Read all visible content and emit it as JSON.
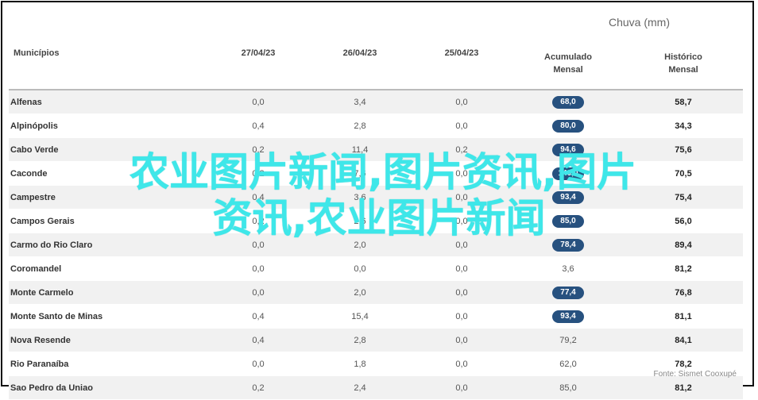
{
  "chart_title": "Chuva (mm)",
  "source": "Fonte: Sismet Cooxupé",
  "overlay": {
    "line1": "农业图片新闻,图片资讯,图片",
    "line2": "资讯,农业图片新闻"
  },
  "table": {
    "headers": {
      "municipio": "Municípios",
      "d1": "27/04/23",
      "d2": "26/04/23",
      "d3": "25/04/23",
      "acum_1": "Acumulado",
      "acum_2": "Mensal",
      "hist_1": "Histórico",
      "hist_2": "Mensal"
    },
    "rows": [
      {
        "municipio": "Alfenas",
        "d1": "0,0",
        "d2": "3,4",
        "d3": "0,0",
        "acum": "68,0",
        "acum_badge": true,
        "hist": "58,7"
      },
      {
        "municipio": "Alpinópolis",
        "d1": "0,4",
        "d2": "2,8",
        "d3": "0,0",
        "acum": "80,0",
        "acum_badge": true,
        "hist": "34,3"
      },
      {
        "municipio": "Cabo Verde",
        "d1": "0,2",
        "d2": "11,4",
        "d3": "0,2",
        "acum": "94,6",
        "acum_badge": true,
        "hist": "75,6"
      },
      {
        "municipio": "Caconde",
        "d1": "0,2",
        "d2": "7,6",
        "d3": "0,0",
        "acum": "140,0",
        "acum_badge": true,
        "hist": "70,5"
      },
      {
        "municipio": "Campestre",
        "d1": "0,4",
        "d2": "3,6",
        "d3": "0,0",
        "acum": "93,4",
        "acum_badge": true,
        "hist": "75,4"
      },
      {
        "municipio": "Campos Gerais",
        "d1": "0,2",
        "d2": "2,6",
        "d3": "0,0",
        "acum": "85,0",
        "acum_badge": true,
        "hist": "56,0"
      },
      {
        "municipio": "Carmo do Rio Claro",
        "d1": "0,0",
        "d2": "2,0",
        "d3": "0,0",
        "acum": "78,4",
        "acum_badge": true,
        "hist": "89,4"
      },
      {
        "municipio": "Coromandel",
        "d1": "0,0",
        "d2": "0,0",
        "d3": "0,0",
        "acum": "3,6",
        "acum_badge": false,
        "hist": "81,2"
      },
      {
        "municipio": "Monte Carmelo",
        "d1": "0,0",
        "d2": "2,0",
        "d3": "0,0",
        "acum": "77,4",
        "acum_badge": true,
        "hist": "76,8"
      },
      {
        "municipio": "Monte Santo de Minas",
        "d1": "0,4",
        "d2": "15,4",
        "d3": "0,0",
        "acum": "93,4",
        "acum_badge": true,
        "hist": "81,1"
      },
      {
        "municipio": "Nova Resende",
        "d1": "0,4",
        "d2": "2,8",
        "d3": "0,0",
        "acum": "79,2",
        "acum_badge": false,
        "hist": "84,1"
      },
      {
        "municipio": "Rio Paranaíba",
        "d1": "0,0",
        "d2": "1,8",
        "d3": "0,0",
        "acum": "62,0",
        "acum_badge": false,
        "hist": "78,2"
      },
      {
        "municipio": "Sao Pedro da Uniao",
        "d1": "0,2",
        "d2": "2,4",
        "d3": "0,0",
        "acum": "85,0",
        "acum_badge": false,
        "hist": "81,2"
      }
    ]
  },
  "colors": {
    "badge": "#27517f",
    "overlay_text": "#3ee7e9"
  }
}
